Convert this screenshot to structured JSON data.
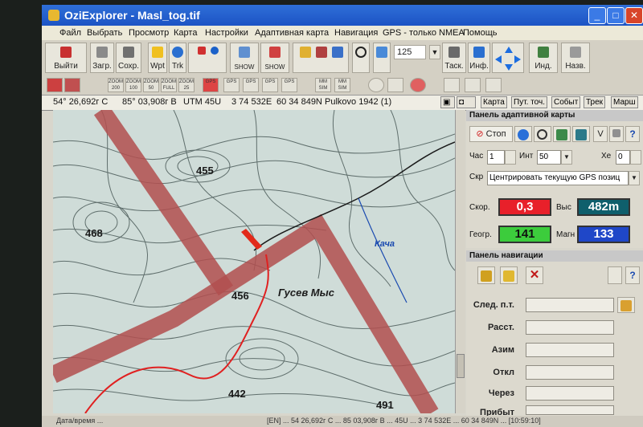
{
  "window": {
    "title": "OziExplorer - Masl_tog.tif",
    "min": "_",
    "max": "□",
    "close": "✕"
  },
  "menu": [
    "Файл",
    "Выбрать",
    "Просмотр",
    "Карта",
    "Настройки",
    "Адаптивная карта",
    "Навигация",
    "GPS - только NMEA",
    "Помощь"
  ],
  "toolbar": {
    "exit": "Выйти",
    "load": "Загр.",
    "save": "Сохр.",
    "wpt": "Wpt",
    "trk": "Trk",
    "show1": "SHOW",
    "show2": "SHOW",
    "zoom_value": "125",
    "task": "Таск.",
    "info": "Инф.",
    "ind": "Инд.",
    "back": "Назв."
  },
  "toolbar2": [
    "ZOOM 200",
    "ZOOM 100",
    "ZOOM 50",
    "ZOOM FULL",
    "ZOOM 25",
    "GPS",
    "GPS",
    "GPS",
    "GPS",
    "GPS",
    "MM SIM",
    "MM SIM"
  ],
  "status": {
    "lat": "54° 26,692г С",
    "lon": "85° 03,908г В",
    "utm": "UTM  45U",
    "east": "3 74 532E",
    "north": "60 34 849N",
    "datum": "Pulkovo 1942 (1)",
    "tabs": [
      "Карта",
      "Пут. точ.",
      "Событ",
      "Трек",
      "Марш"
    ]
  },
  "map": {
    "labels": [
      "455",
      "468",
      "456",
      "442",
      "491",
      "Гусев Мыс",
      "Кача"
    ]
  },
  "adaptive_panel": {
    "title": "Панель адаптивной карты",
    "stop": "Стоп",
    "hour_label": "Час",
    "hour_value": "1",
    "int_label": "Инт",
    "int_value": "50",
    "xe_label": "Хе",
    "xe_value": "0",
    "scr_label": "Скр",
    "scr_value": "Центрировать текущую GPS позиц",
    "speed_label": "Скор.",
    "speed_value": "0,3",
    "alt_label": "Выс",
    "alt_value": "482m",
    "geo_label": "Геогр.",
    "geo_value": "141",
    "mag_label": "Магн",
    "mag_value": "133",
    "colors": {
      "speed": "#e8202a",
      "alt": "#0f5f6c",
      "geo": "#3ccc3c",
      "mag": "#1f47c8"
    }
  },
  "nav_panel": {
    "title": "Панель навигации",
    "fields": [
      "След. п.т.",
      "Расст.",
      "Азим",
      "Откл",
      "Через",
      "Прибыт"
    ]
  },
  "bottom": {
    "left": "Дата/время ...",
    "right": "[EN] ... 54 26,692г С ... 85 03,908г В ... 45U ... 3 74 532E ... 60 34 849N ... [10:59:10]"
  }
}
